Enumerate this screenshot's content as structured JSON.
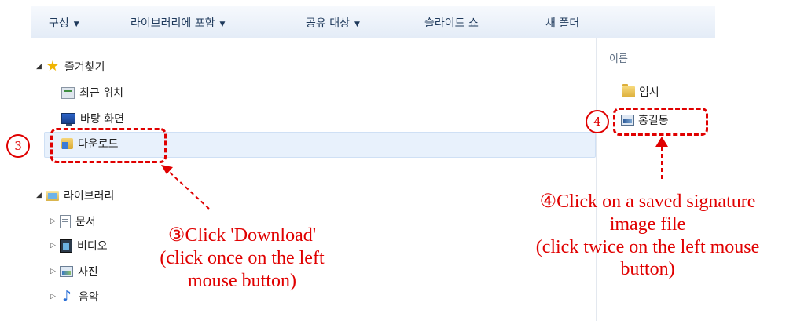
{
  "toolbar": {
    "organize": "구성",
    "include_in_library": "라이브러리에 포함",
    "share_with": "공유 대상",
    "slideshow": "슬라이드 쇼",
    "new_folder": "새 폴더"
  },
  "nav": {
    "favorites": {
      "label": "즐겨찾기",
      "items": [
        {
          "label": "최근 위치",
          "icon": "recent-places-icon"
        },
        {
          "label": "바탕 화면",
          "icon": "desktop-icon"
        },
        {
          "label": "다운로드",
          "icon": "download-folder-icon",
          "selected": true
        }
      ]
    },
    "libraries": {
      "label": "라이브러리",
      "items": [
        {
          "label": "문서",
          "icon": "documents-icon"
        },
        {
          "label": "비디오",
          "icon": "video-icon"
        },
        {
          "label": "사진",
          "icon": "pictures-icon"
        },
        {
          "label": "음악",
          "icon": "music-icon"
        }
      ]
    }
  },
  "file_list": {
    "column_name": "이름",
    "items": [
      {
        "label": "임시",
        "icon": "folder-icon"
      },
      {
        "label": "홍길동",
        "icon": "image-file-icon"
      }
    ]
  },
  "annotations": {
    "step3_number": "3",
    "step3_line1": "③Click 'Download'",
    "step3_line2": "(click once on the left",
    "step3_line3": "mouse button)",
    "step4_number": "4",
    "step4_line1": "④Click on a saved signature",
    "step4_line2": "image file",
    "step4_line3": "(click twice on the left mouse",
    "step4_line4": "button)"
  },
  "colors": {
    "annotation": "#e00000",
    "toolbar_text": "#1e395b",
    "selection": "#e8f1fc"
  }
}
